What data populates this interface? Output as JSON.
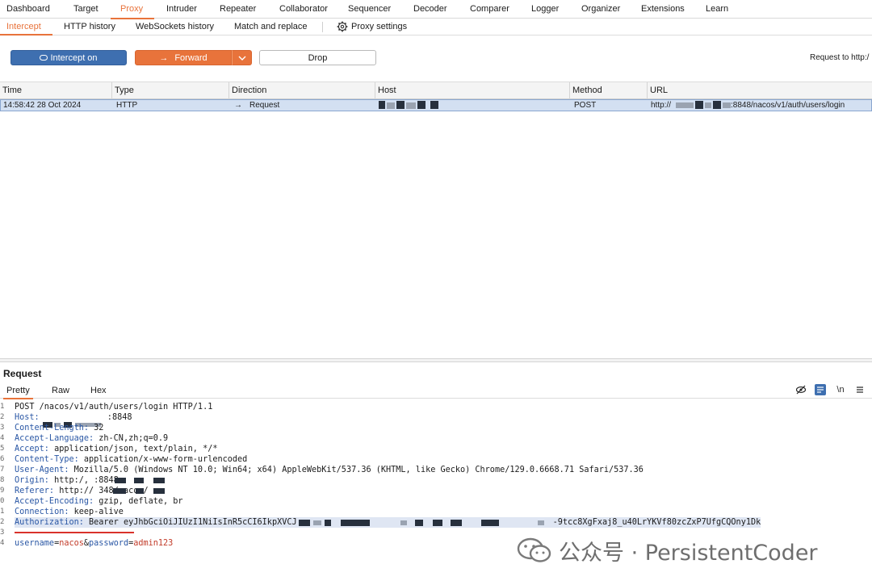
{
  "top_tabs": [
    "Dashboard",
    "Target",
    "Proxy",
    "Intruder",
    "Repeater",
    "Collaborator",
    "Sequencer",
    "Decoder",
    "Comparer",
    "Logger",
    "Organizer",
    "Extensions",
    "Learn"
  ],
  "sub_tabs": [
    "Intercept",
    "HTTP history",
    "WebSockets history",
    "Match and replace"
  ],
  "proxy_settings": "Proxy settings",
  "toolbar": {
    "intercept": "Intercept on",
    "forward": "Forward",
    "drop": "Drop",
    "request_to": "Request to http:/"
  },
  "table": {
    "headers": [
      "Time",
      "Type",
      "Direction",
      "Host",
      "Method",
      "URL"
    ],
    "row": {
      "time": "14:58:42 28 Oct 2024",
      "type": "HTTP",
      "direction": "Request",
      "method": "POST",
      "url_prefix": "http://",
      "url_suffix": ":8848/nacos/v1/auth/users/login"
    }
  },
  "request": {
    "title": "Request",
    "tabs": [
      "Pretty",
      "Raw",
      "Hex"
    ],
    "newline_toggle": "\\n",
    "lines": [
      {
        "n": "1",
        "key": "",
        "value": "POST /nacos/v1/auth/users/login HTTP/1.1"
      },
      {
        "n": "2",
        "key": "Host:",
        "value": "  :8848"
      },
      {
        "n": "3",
        "key": "Content-Length:",
        "value": " 32"
      },
      {
        "n": "4",
        "key": "Accept-Language:",
        "value": " zh-CN,zh;q=0.9"
      },
      {
        "n": "5",
        "key": "Accept:",
        "value": " application/json, text/plain, */*"
      },
      {
        "n": "6",
        "key": "Content-Type:",
        "value": " application/x-www-form-urlencoded"
      },
      {
        "n": "7",
        "key": "User-Agent:",
        "value": " Mozilla/5.0 (Windows NT 10.0; Win64; x64) AppleWebKit/537.36 (KHTML, like Gecko) Chrome/129.0.6668.71 Safari/537.36"
      },
      {
        "n": "8",
        "key": "Origin:",
        "value": " http:/,            :8848"
      },
      {
        "n": "9",
        "key": "Referer:",
        "value": " http://                348/nacos/"
      },
      {
        "n": "0",
        "key": "Accept-Encoding:",
        "value": " gzip, deflate, br"
      },
      {
        "n": "1",
        "key": "Connection:",
        "value": " keep-alive"
      },
      {
        "n": "2",
        "key": "Authorization:",
        "value": " Bearer eyJhbGciOiJIUzI1NiIsInR5cCI6IkpXVCJ",
        "tail": "-9tcc8XgFxaj8_u40LrYKVf80zcZxP7UfgCQOny1Dk"
      },
      {
        "n": "3",
        "key": "",
        "value": ""
      },
      {
        "n": "4",
        "key": "username",
        "value": "nacos",
        "key2": "password",
        "value2": "admin123"
      }
    ]
  },
  "watermark": "公众号 · PersistentCoder"
}
